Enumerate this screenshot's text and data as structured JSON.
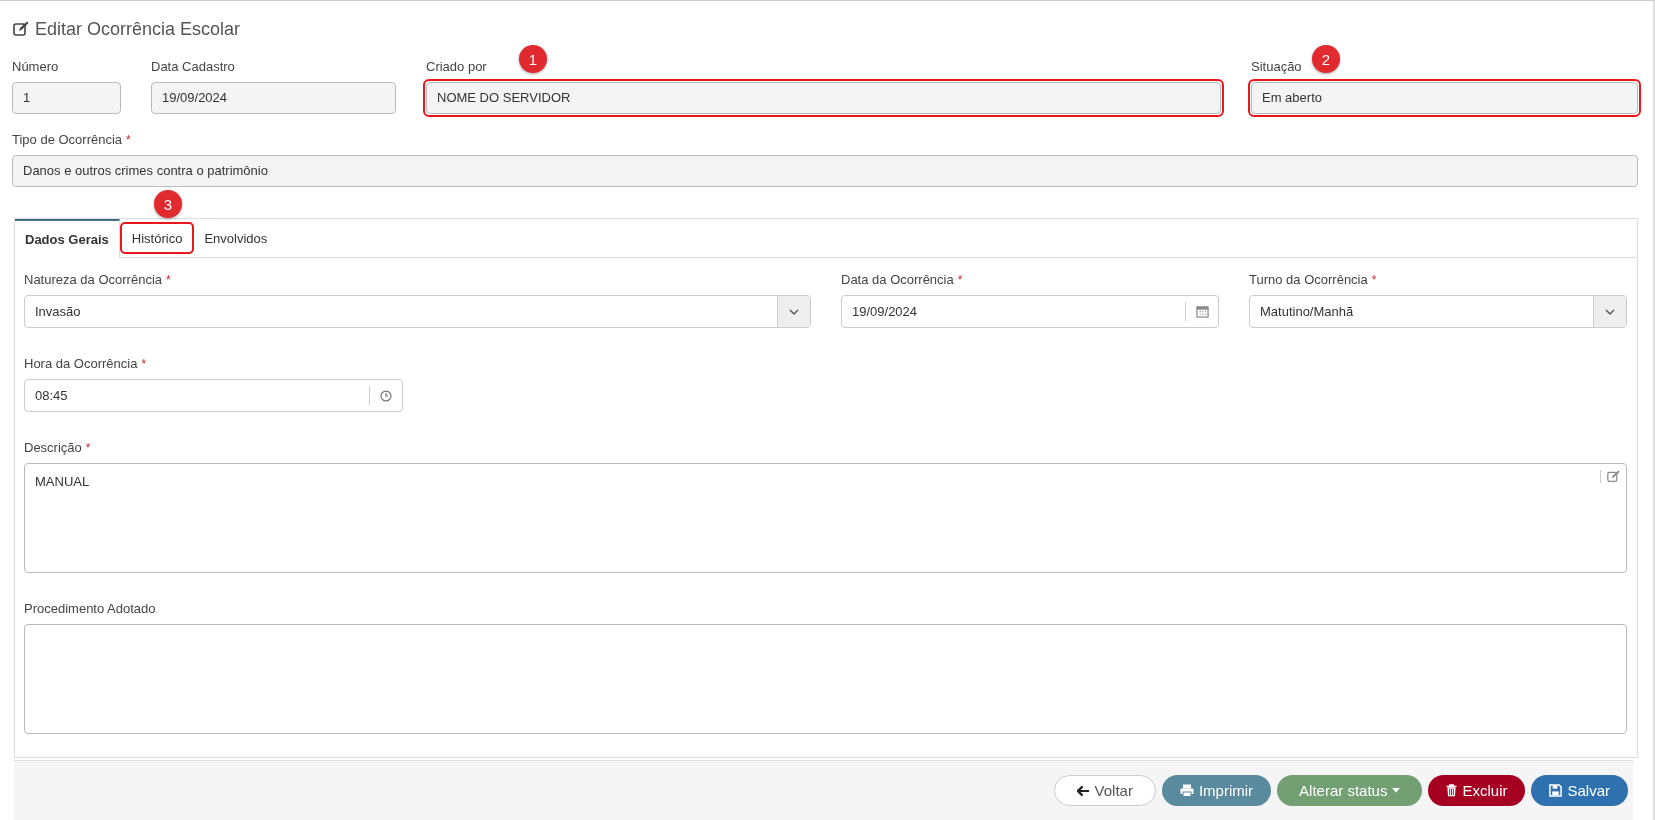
{
  "page": {
    "title": "Editar Ocorrência Escolar"
  },
  "header_fields": [
    {
      "label": "Número",
      "value": "1"
    },
    {
      "label": "Data Cadastro",
      "value": "19/09/2024"
    },
    {
      "label": "Criado por",
      "value": "NOME DO SERVIDOR",
      "marker": "1"
    },
    {
      "label": "Situação",
      "value": "Em aberto",
      "marker": "2"
    }
  ],
  "type_field": {
    "label": "Tipo de Ocorrência",
    "required_mark": "*",
    "value": "Danos e outros crimes contra o patrimônio"
  },
  "tabs": [
    {
      "label": "Dados Gerais",
      "selected": true
    },
    {
      "label": "Histórico",
      "selected": false,
      "marker": "3"
    },
    {
      "label": "Envolvidos",
      "selected": false
    }
  ],
  "form_rows": [
    [
      {
        "kind": "select",
        "label": "Natureza da Ocorrência",
        "required_mark": "*",
        "value": "Invasão"
      },
      {
        "kind": "date",
        "label": "Data da Ocorrência",
        "required_mark": "*",
        "value": "19/09/2024"
      },
      {
        "kind": "select",
        "label": "Turno da Ocorrência",
        "required_mark": "*",
        "value": "Matutino/Manhã"
      }
    ],
    [
      {
        "kind": "time",
        "label": "Hora da Ocorrência",
        "required_mark": "*",
        "value": "08:45"
      }
    ],
    [
      {
        "kind": "editor",
        "label": "Descrição",
        "required_mark": "*",
        "value": "MANUAL"
      }
    ],
    [
      {
        "kind": "textarea",
        "label": "Procedimento Adotado"
      }
    ]
  ],
  "buttons": [
    {
      "kind": "back",
      "label": "Voltar"
    },
    {
      "kind": "print",
      "label": "Imprimir"
    },
    {
      "kind": "status",
      "label": "Alterar status"
    },
    {
      "kind": "delete",
      "label": "Excluir"
    },
    {
      "kind": "save",
      "label": "Salvar"
    }
  ]
}
